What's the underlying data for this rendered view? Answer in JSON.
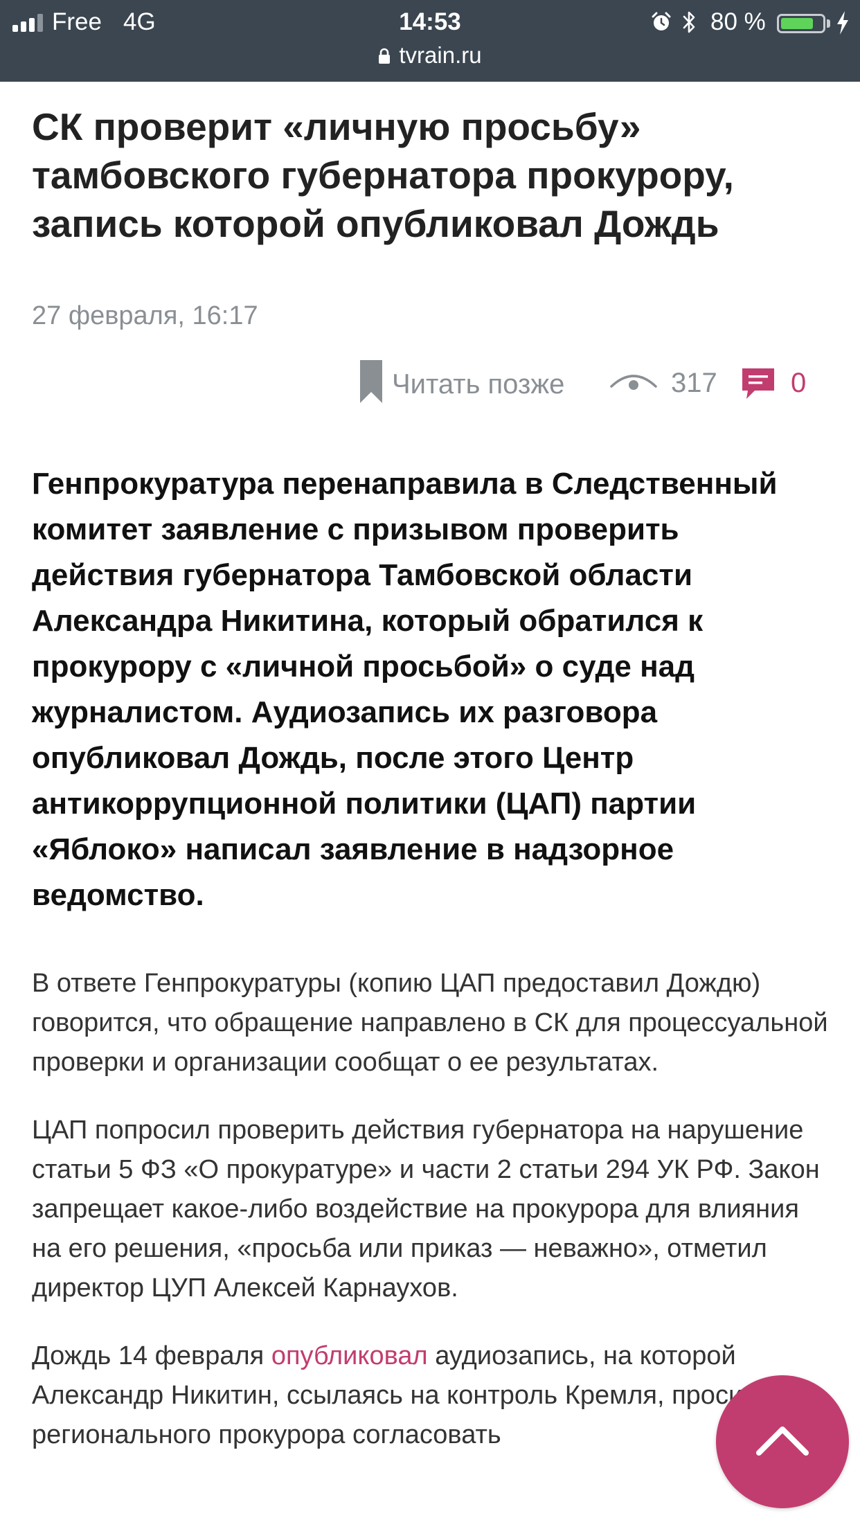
{
  "status_bar": {
    "carrier": "Free",
    "network": "4G",
    "time": "14:53",
    "battery_percent_label": "80 %",
    "battery_level": 0.8,
    "url": "tvrain.ru"
  },
  "article": {
    "title": "СК проверит «личную просьбу» тамбовского губернатора прокурору, запись которой опубликовал Дождь",
    "date": "27 февраля, 16:17",
    "read_later_label": "Читать позже",
    "views": "317",
    "comments": "0",
    "lead": "Генпрокуратура перенаправила в Следственный комитет заявление с призывом проверить действия губернатора Тамбовской области Александра Никитина, который обратился к прокурору с «личной просьбой» о суде над журналистом. Аудиозапись их разговора опубликовал Дождь, после этого Центр антикоррупционной политики (ЦАП) партии «Яблоко» написал заявление в надзорное ведомство.",
    "paragraph_1": "В ответе Генпрокуратуры (копию ЦАП предоставил Дождю) говорится, что обращение направлено в СК для процессуальной проверки и организации сообщат о ее результатах.",
    "paragraph_2": "ЦАП попросил проверить действия губернатора на нарушение статьи 5 ФЗ «О прокуратуре» и части 2 статьи 294 УК РФ. Закон запрещает какое-либо воздействие на прокурора для влияния на его решения, «просьба или приказ — неважно», отметил директор ЦУП Алексей Карнаухов.",
    "paragraph_3_before": "Дождь 14 февраля ",
    "paragraph_3_link": "опубликовал",
    "paragraph_3_after": " аудиозапись, на которой Александр Никитин, ссылаясь на контроль Кремля, просит регионального прокурора согласовать"
  },
  "colors": {
    "accent": "#c23d6f",
    "status_bar_bg": "#3b4650",
    "battery": "#5fd45a"
  },
  "icons": [
    "signal-icon",
    "alarm-icon",
    "bluetooth-icon",
    "battery-icon",
    "charging-bolt-icon",
    "lock-icon",
    "bookmark-icon",
    "eye-icon",
    "comment-icon",
    "chevron-up-icon"
  ]
}
